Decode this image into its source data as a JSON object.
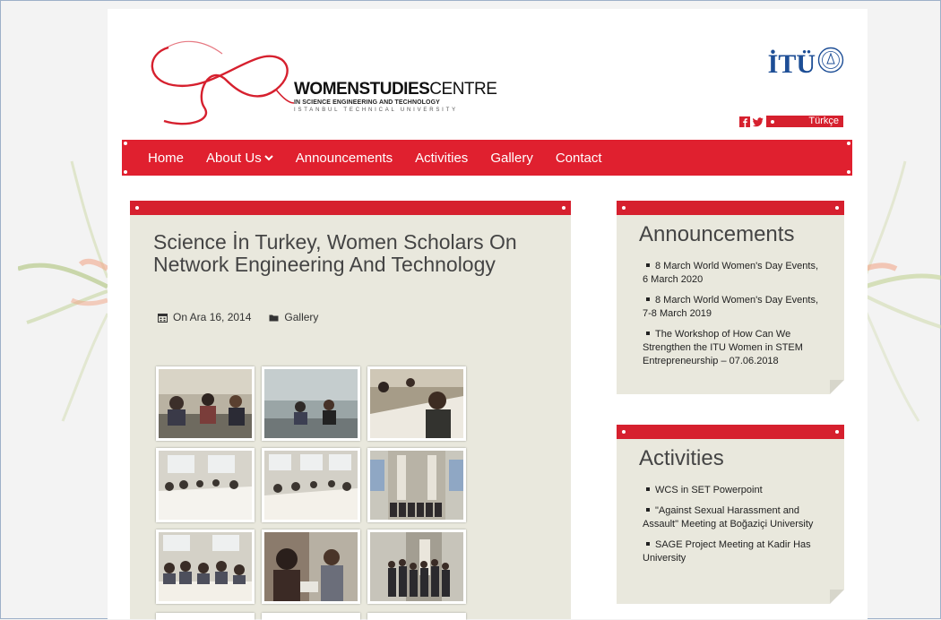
{
  "header": {
    "logo_bold": "WOMEN",
    "logo_bold2": "STUDIES",
    "logo_light": "CENTRE",
    "logo_line2": "IN SCIENCE ENGINEERING AND TECHNOLOGY",
    "logo_line3": "ISTANBUL TECHNICAL UNIVERSITY",
    "itu_text": "İTÜ",
    "language_label": "Türkçe"
  },
  "nav": {
    "items": [
      {
        "label": "Home"
      },
      {
        "label": "About Us"
      },
      {
        "label": "Announcements"
      },
      {
        "label": "Activities"
      },
      {
        "label": "Gallery"
      },
      {
        "label": "Contact"
      }
    ]
  },
  "post": {
    "title": "Science İn Turkey, Women Scholars On Network Engineering And Technology",
    "date": "On Ara 16, 2014",
    "category": "Gallery"
  },
  "announcements": {
    "title": "Announcements",
    "items": [
      "8 March World Women's Day Events, 6 March 2020",
      "8 March World Women's Day Events, 7-8 March 2019",
      "The Workshop of How Can We Strengthen the ITU Women in STEM Entrepreneurship – 07.06.2018"
    ]
  },
  "activities": {
    "title": "Activities",
    "items": [
      "WCS in SET Powerpoint",
      "\"Against Sexual Harassment and Assault\" Meeting at Boğaziçi University",
      "SAGE Project Meeting at Kadir Has University"
    ]
  },
  "colors": {
    "accent": "#d6202e",
    "card_bg": "#e9e8dd",
    "itu_blue": "#1d4e96"
  },
  "icons": {
    "facebook": "facebook-icon",
    "twitter": "twitter-icon",
    "calendar": "calendar-icon",
    "folder": "folder-icon",
    "dropdown": "chevron-down-icon"
  }
}
